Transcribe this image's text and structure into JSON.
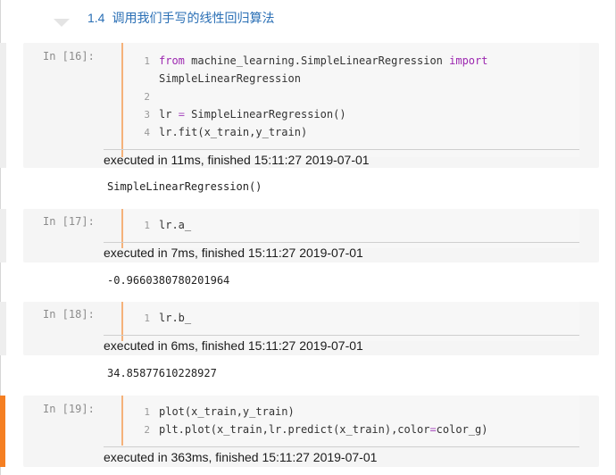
{
  "heading": {
    "number": "1.4",
    "title": "调用我们手写的线性回归算法"
  },
  "cells": [
    {
      "prompt": "In [16]:",
      "lines": [
        {
          "n": "1",
          "text": "from machine_learning.SimpleLinearRegression import"
        },
        {
          "n": "",
          "text": "SimpleLinearRegression"
        },
        {
          "n": "2",
          "text": ""
        },
        {
          "n": "3",
          "text": "lr = SimpleLinearRegression()"
        },
        {
          "n": "4",
          "text": "lr.fit(x_train,y_train)"
        }
      ],
      "exec": "executed in 11ms, finished 15:11:27 2019-07-01",
      "output": "SimpleLinearRegression()"
    },
    {
      "prompt": "In [17]:",
      "lines": [
        {
          "n": "1",
          "text": "lr.a_"
        }
      ],
      "exec": "executed in 7ms, finished 15:11:27 2019-07-01",
      "output": "-0.9660380780201964"
    },
    {
      "prompt": "In [18]:",
      "lines": [
        {
          "n": "1",
          "text": "lr.b_"
        }
      ],
      "exec": "executed in 6ms, finished 15:11:27 2019-07-01",
      "output": "34.85877610228927"
    },
    {
      "prompt": "In [19]:",
      "lines": [
        {
          "n": "1",
          "text": "plot(x_train,y_train)"
        },
        {
          "n": "2",
          "text": "plt.plot(x_train,lr.predict(x_train),color=color_g)"
        }
      ],
      "exec": "executed in 363ms, finished 15:11:27 2019-07-01",
      "output": ""
    }
  ],
  "colors": {
    "accent": "#f57f22",
    "heading": "#2a6fb5"
  }
}
